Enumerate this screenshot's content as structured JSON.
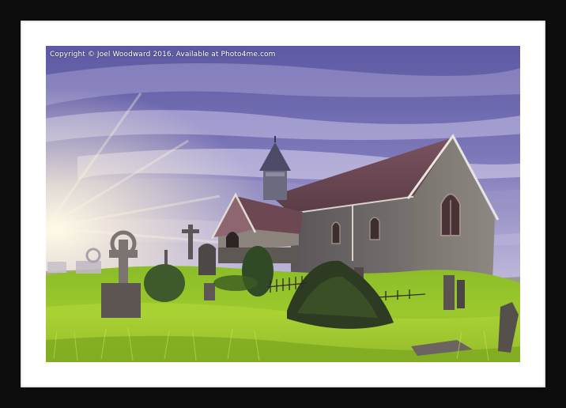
{
  "watermark": {
    "text": "Copyright  © Joel Woodward  2016. Available at Photo4me.com"
  },
  "colors": {
    "frame": "#0c0c0c",
    "mount": "#ffffff",
    "sky_top": "#5f5aa0",
    "sky_light": "#e7e3f6",
    "grass": "#a7cf2c",
    "stone": "#6c6a6a",
    "roof": "#6a4a52"
  }
}
